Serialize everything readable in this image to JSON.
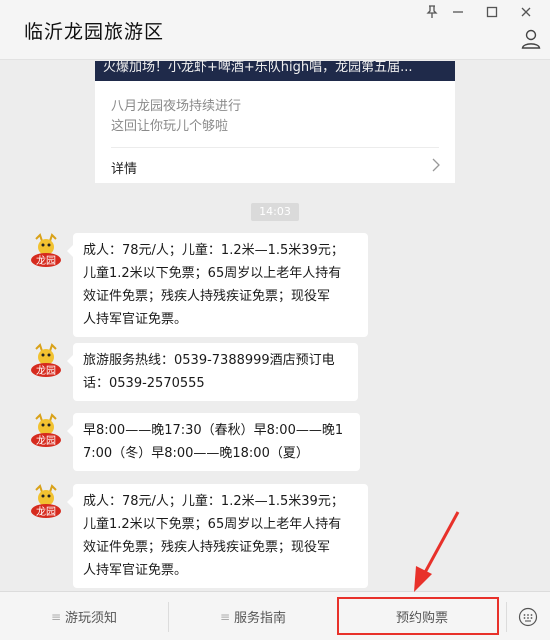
{
  "window": {
    "title": "临沂龙园旅游区"
  },
  "article": {
    "banner_text": "火爆加场！小龙虾+啤酒+乐队high唱，龙园第五届...",
    "desc_line1": "八月龙园夜场持续进行",
    "desc_line2": "这回让你玩儿个够啦",
    "detail_label": "详情"
  },
  "chat": {
    "timestamp": "14:03",
    "messages": [
      {
        "lines": [
          "成人：78元/人；儿童：1.2米—1.5米39元；",
          "儿童1.2米以下免票；65周岁以上老年人持有",
          "效证件免票；残疾人持残疾证免票；现役军",
          "人持军官证免票。"
        ]
      },
      {
        "lines": [
          "旅游服务热线：0539-7388999酒店预订电",
          "话：0539-2570555"
        ]
      },
      {
        "lines": [
          "早8:00——晚17:30（春秋）早8:00——晚1",
          "7:00（冬）早8:00——晚18:00（夏）"
        ]
      },
      {
        "lines": [
          "成人：78元/人；儿童：1.2米—1.5米39元；",
          "儿童1.2米以下免票；65周岁以上老年人持有",
          "效证件免票；残疾人持残疾证免票；现役军",
          "人持军官证免票。"
        ]
      }
    ],
    "avatar_logo_text": "龙园"
  },
  "menu": {
    "items": [
      {
        "label": "游玩须知",
        "has_burger": true
      },
      {
        "label": "服务指南",
        "has_burger": true
      },
      {
        "label": "预约购票",
        "has_burger": false
      }
    ]
  },
  "colors": {
    "annotation": "#e8312a",
    "banner": "#1f2a4a"
  }
}
